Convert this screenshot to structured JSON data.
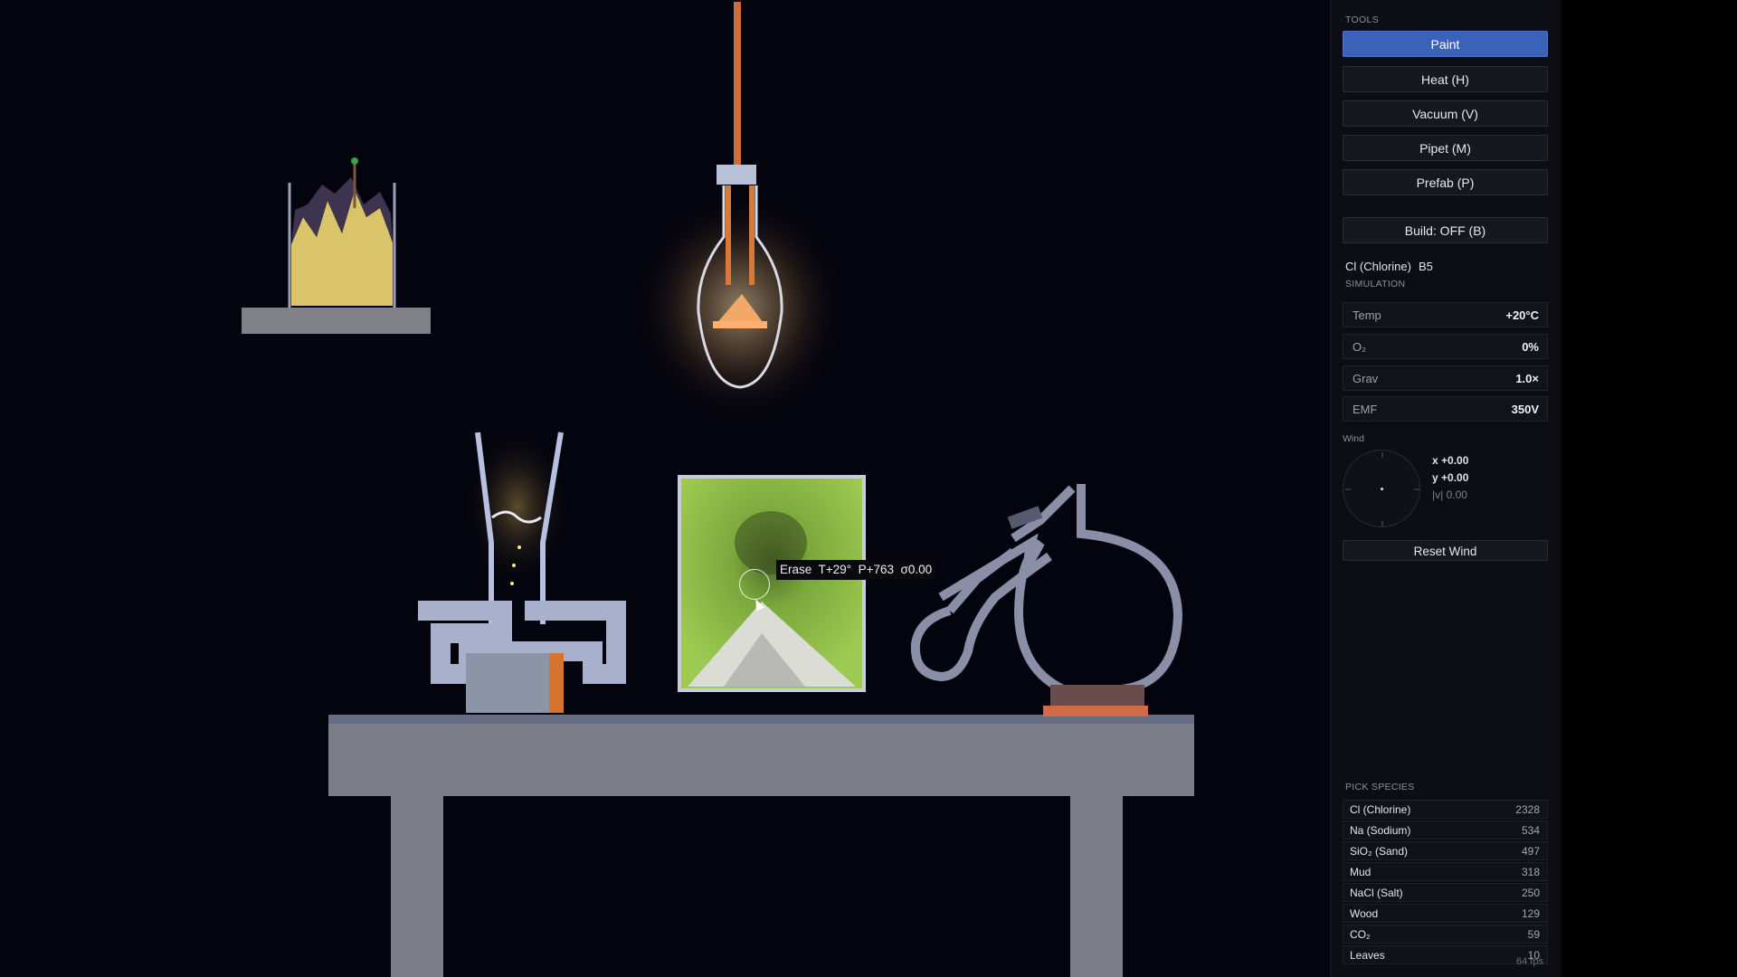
{
  "tools": {
    "section_label": "TOOLS",
    "buttons": [
      {
        "label": "Paint",
        "active": true
      },
      {
        "label": "Heat  (H)",
        "active": false
      },
      {
        "label": "Vacuum  (V)",
        "active": false
      },
      {
        "label": "Pipet  (M)",
        "active": false
      },
      {
        "label": "Prefab  (P)",
        "active": false
      }
    ],
    "build_label": "Build: OFF  (B)"
  },
  "selected": {
    "name": "Cl (Chlorine)",
    "code": "B5"
  },
  "simulation": {
    "section_label": "SIMULATION",
    "params": [
      {
        "key": "Temp",
        "value": "+20°C"
      },
      {
        "key": "O₂",
        "value": "0%"
      },
      {
        "key": "Grav",
        "value": "1.0×"
      },
      {
        "key": "EMF",
        "value": "350V"
      }
    ]
  },
  "wind": {
    "label": "Wind",
    "x": "x +0.00",
    "y": "y +0.00",
    "magnitude": "|v| 0.00",
    "reset_label": "Reset Wind"
  },
  "species": {
    "section_label": "PICK SPECIES",
    "items": [
      {
        "name": "Cl (Chlorine)",
        "count": "2328"
      },
      {
        "name": "Na (Sodium)",
        "count": "534"
      },
      {
        "name": "SiO₂ (Sand)",
        "count": "497"
      },
      {
        "name": "Mud",
        "count": "318"
      },
      {
        "name": "NaCl (Salt)",
        "count": "250"
      },
      {
        "name": "Wood",
        "count": "129"
      },
      {
        "name": "CO₂",
        "count": "59"
      },
      {
        "name": "Leaves",
        "count": "10"
      }
    ]
  },
  "fps": "64 fps",
  "cursor_tooltip": "Erase  T+29°  P+763  σ0.00",
  "colors": {
    "accent": "#3a62b8",
    "stone": "#808088",
    "glass": "#b4bcdc",
    "copper": "#d6742e",
    "green_field": "#8fc24a",
    "sand": "#e8e6e0"
  }
}
